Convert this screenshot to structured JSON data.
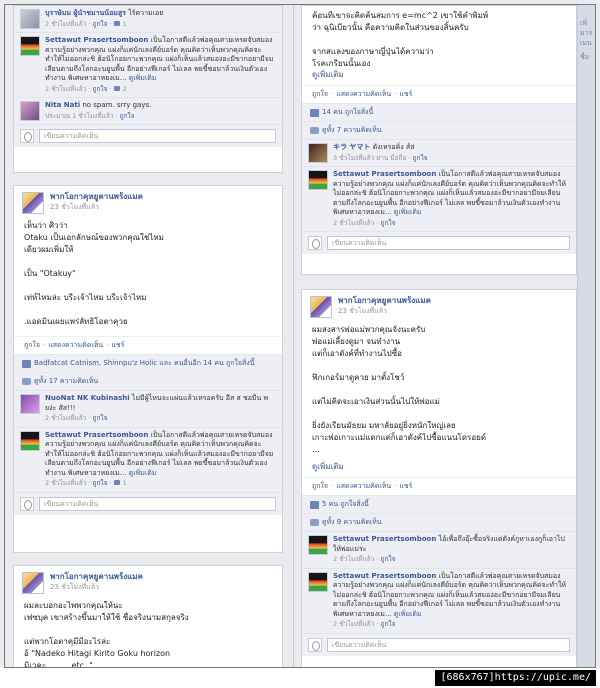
{
  "edge_texts": [
    "เพิ่",
    "มาร",
    "เมน",
    "ชื่อ"
  ],
  "left": {
    "top_card": {
      "c1": {
        "name": "บุราษัมม ผู้นำชมานน้อมสูร",
        "text": "ไร้ความเอย",
        "meta": "2 ชั่วโมงที่แล้ว",
        "like": "ถูกใจ",
        "likes": "1"
      },
      "c2": {
        "name": "Settawut Prasertsomboon",
        "text": "เป็นโอกาสดีแล้วพ่อคุณสายเหรดจับสมองความรู้อย่างพวกคุณ แผ่งก็แค่นักเลงคีย์บอร์ด คุณคิดว่าเห็นพวกคุณคิดจะทำให้ไม่ออกล่ะชิ ฮ้อนิโกอยกาะพวกคุณ แผ่งก็เห็นแล้วสมองอะมีขากอยามีจมเลียนตามถึงโลกอะนยูนพื้น อีกอย่างฟีเกอร์ ไม่เลล พยขี้ซอมาล้วนเงินตัวเองทำงาน พิเศษหาอาหยงเม...",
        "more": "ดูเพิ่มเติม",
        "meta": "2 ชั่วโมงที่แล้ว",
        "like": "ถูกใจ",
        "likes": "2"
      },
      "c3": {
        "name": "Nita Nati",
        "text": "no spam. srry gays.",
        "meta": "ประมาณ 1 ชั่วโมงที่แล้ว",
        "like": "ถูกใจ"
      },
      "write": "เขียนความคิดเห็น"
    },
    "post1": {
      "author": "พากโอกาคุหยูคานพร้งแมค",
      "time": "23 ชั่วโมงที่แล้ว",
      "body": "เห็นว่า ศิวว่า\nOtaku เป็นเอกลักษณ์ของพวกคุณใช่ไหม\nเดียวผมเพิ่มให้\n\nเป็น \"Otakuy\"\n\nเท่ห์ไหมล่ะ บรีะเจ้าไหม บรีะเจ้าไหม\n\n.แอดมินเผยแพร่ลัทธิโอตาคุวย",
      "action_like": "ถูกใจ",
      "action_comment": "แสดงความคิดเห็น",
      "action_share": "แชร์",
      "likes_text": "Badfatcat Catnism, Shinnpu'z Holic และ คนอื่นอีก 14 คน ถูกใจสิ่งนี้",
      "comments_count": "ดูทั้ง 17 ความคิดเห็น",
      "c1": {
        "name": "NuoNat NK Kubinashi",
        "text": "ไม่มีผู้ไหนจะแผ่นแล้วเหรอครับ อีส ส ชอมีน พยง่ะ สัส!!!",
        "meta": "2 ชั่วโมงที่แล้ว",
        "like": "ถูกใจ"
      },
      "c2": {
        "name": "Settawut Prasertsomboon",
        "text": "เป็นโอกาสดีแล้วพ่อคุณสายเหรดจับสมองความรู้อย่างพวกคุณ แผ่งก็แค่นักเลงคีย์บอร์ด คุณคิดว่าเห็นพวกคุณคิดจะทำให้ไม่ออกล่ะชิ ฮ้อนิโกอยกาะพวกคุณ แผ่งก็เห็นแล้วสมองอะมีขากอยามีจมเลียนตามถึงโลกอะนยูนพื้น อีกอย่างฟีเกอร์ ไม่เลล พยขี้ซอมาล้วนเงินตัวเองทำงาน พิเศษหาอาหยงเม...",
        "more": "ดูเพิ่มเติม",
        "meta": "2 ชั่วโมงที่แล้ว",
        "like": "ถูกใจ",
        "likes": "1"
      },
      "write": "เขียนความคิดเห็น"
    },
    "post2": {
      "author": "พากโอกาคุหยูคานพร้งแมค",
      "time": "23 ชั่วโมงที่แล้ว",
      "body": "ผมละบอกอะไพพวกคุณให้นะ\nเฟซบุค เขาสร้างขึ้นมาให้ใช้ ชื่อจริงนามสกุลจริง\n\nแต่พวกโอตาคุมีมีอะไรล่ะ\nอ้ \"Nadeko Hitagi Kirito Goku horizon\nมิเวคะ          etc..\""
    }
  },
  "right": {
    "top_card": {
      "body": "ค้อนทีเขาจะคิดค้นสมการ e=mc^2 เขาใช้คำพิมพ์\nว่า ฉุนิเบียวนั้น คือความคิดในส่วนของสิ้นครับ\n\nจากสแลงของภาษาญี่ปุ่นได้ความว่า\nโรคเกรียนนั้นเอง\n...",
      "more": "ดูเพิ่มเติม",
      "action_like": "ถูกใจ",
      "action_comment": "แสดงความคิดเห็น",
      "action_share": "แชร์",
      "likes_text": "14 คน ถูกใจสิ่งนี้",
      "comments_count": "ดูทั้ง 7 ความคิดเห็น",
      "c1": {
        "name": "キラ ヤマト",
        "text": "ดังเหรอคิ่ง ส์ส",
        "meta": "3 ชั่วโมงที่แล้ว ผ่าน มือถือ",
        "like": "ถูกใจ"
      },
      "c2": {
        "name": "Settawut Prasertsomboon",
        "text": "เป็นโอกาสดีแล้วพ่อคุณสายเหรดจับสมองความรู้อย่างพวกคุณ แผ่งก็แค่นักเลงคีย์บอร์ด คุณคิดว่าเห็นพวกคุณคิดจะทำให้ไม่ออกล่ะชิ ฮ้อนิโกอยกาะพวกคุณ แผ่งก็เห็นแล้วสมองอะมีขากอยามีจมเลียนตามถึงโลกอะนยูนพื้น อีกอย่างฟีเกอร์ ไม่เลล พยขี้ซอมาล้วนเงินตัวเองทำงาน พิเศษหาอาหยงเม...",
        "more": "ดูเพิ่มเติม",
        "meta": "2 ชั่วโมงที่แล้ว",
        "like": "ถูกใจ"
      },
      "write": "เขียนความคิดเห็น"
    },
    "post1": {
      "author": "พากโอกาคุหยูคานพร้งแมค",
      "time": "23 ชั่วโมงที่แล้ว",
      "body": "ผมสงสารพ่อแม่พวกคุณจังนะครับ\nพ่อแม่เลี้ยงดูมา จนทำงาน\nแต่ก็เอาตังค์ที่ทำงานไปซื้อ\n\nฟิกเกอร์มาดูควย มาตั้งโชว์\n\nแต่ไม่คิดจะเอาเงินส่วนนั้นไปให้พ่อแม่\n\nยิ่งยังเรียนมัธยม มหาลัยอยู่ยิ่งหนักใหญ่เลย\nเกาะพ่อเกาะแม่แดกแต่ก็เอาตังค์ไปซื้อแนนโดรอยด์\n...",
      "more": "ดูเพิ่มเติม",
      "action_like": "ถูกใจ",
      "action_comment": "แสดงความคิดเห็น",
      "action_share": "แชร์",
      "likes_text": "5 คน ถูกใจสิ่งนี้",
      "comments_count": "ดูทั้ง 9 ความคิดเห็น",
      "c1": {
        "name": "Settawut Prasertsomboon",
        "text": "ไอ้เพื่อถึงอุ๊ะซื้อจริงแต่ตังค์กูหาเองกูก็เอาไปให้พ่อแม่ระ",
        "meta": "2 ชั่วโมงที่แล้ว",
        "like": "ถูกใจ"
      },
      "c2": {
        "name": "Settawut Prasertsomboon",
        "text": "เป็นโอกาสดีแล้วพ่อคุณสายเหรดจับสมองความรู้อย่างพวกคุณ แผ่งก็แค่นักเลงคีย์บอร์ด คุณคิดว่าเห็นพวกคุณคิดจะทำให้ไม่ออกล่ะชิ ฮ้อนิโกอยกาะพวกคุณ แผ่งก็เห็นแล้วสมองอะมีขากอยามีจมเลียนตามถึงโลกอะนยูนพื้น อีกอย่างฟีเกอร์ ไม่เลล พยขี้ซอมาล้วนเงินตัวเองทำงาน พิเศษหาอาหยงเม...",
        "more": "ดูเพิ่มเติม",
        "meta": "2 ชั่วโมงที่แล้ว",
        "like": "ถูกใจ"
      },
      "write": "เขียนความคิดเห็น"
    }
  },
  "watermark": "[686x767]https://upic.me/"
}
